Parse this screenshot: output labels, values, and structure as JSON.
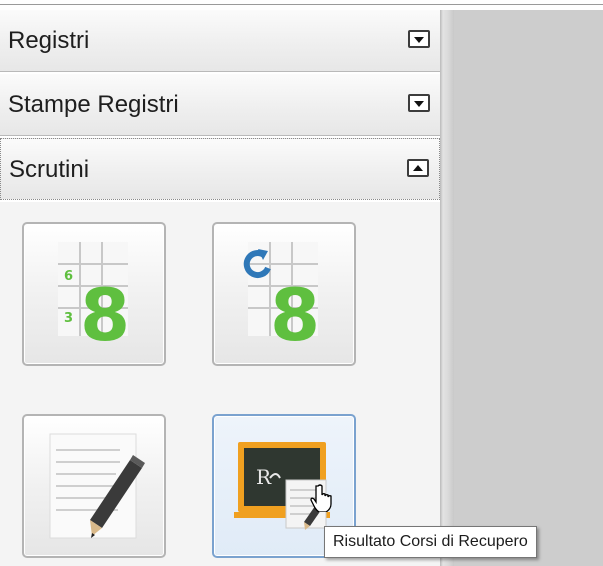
{
  "accordion": {
    "sections": [
      {
        "label": "Registri",
        "state": "collapsed"
      },
      {
        "label": "Stampe Registri",
        "state": "collapsed"
      },
      {
        "label": "Scrutini",
        "state": "expanded"
      }
    ]
  },
  "tiles": [
    {
      "icon": "grade-grid-8-icon",
      "digits": [
        "6",
        "3"
      ],
      "big_digit": "8"
    },
    {
      "icon": "grade-refresh-8-icon",
      "big_digit": "8"
    },
    {
      "icon": "notes-pencil-icon"
    },
    {
      "icon": "blackboard-recovery-icon",
      "board_text": "R"
    }
  ],
  "tooltip": {
    "text": "Risultato Corsi di Recupero"
  },
  "colors": {
    "grade_green": "#5fbf3f",
    "refresh_blue": "#2f78b8",
    "blackboard_frame": "#f0a020",
    "blackboard": "#2f3730",
    "pencil": "#3a3a3a"
  }
}
